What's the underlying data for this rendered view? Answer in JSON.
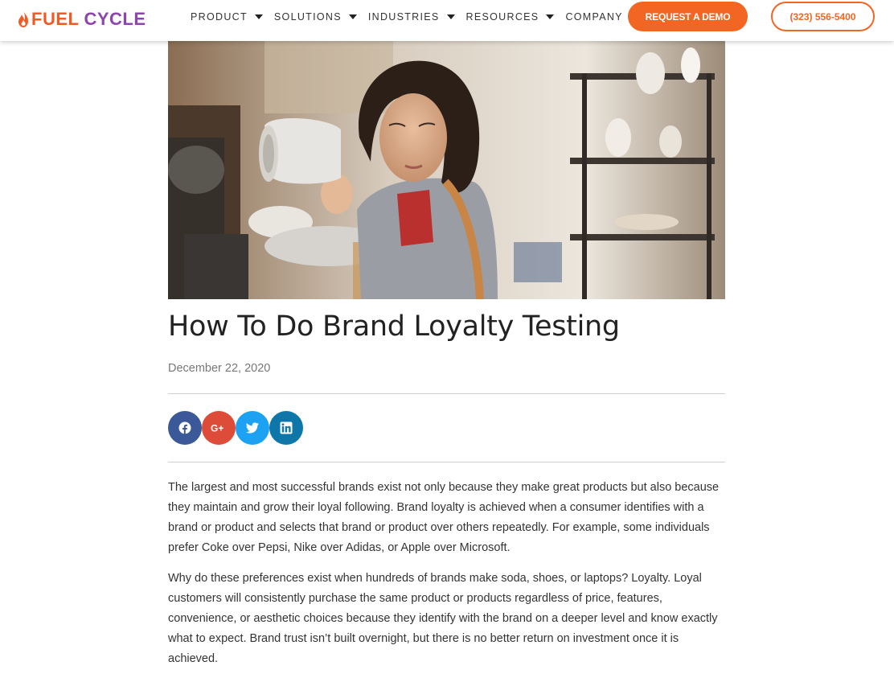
{
  "brand": {
    "logo_part1": "FUEL",
    "logo_part2": "CYCLE",
    "accent": "#f26522",
    "secondary": "#8e44ad"
  },
  "nav": {
    "items": [
      {
        "label": "PRODUCT"
      },
      {
        "label": "SOLUTIONS"
      },
      {
        "label": "INDUSTRIES"
      },
      {
        "label": "RESOURCES"
      },
      {
        "label": "COMPANY"
      }
    ],
    "demo_label": "REQUEST A DEMO",
    "phone_label": "(323) 556-5400"
  },
  "article": {
    "title": "How To Do Brand Loyalty Testing",
    "date": "December 22, 2020",
    "paragraphs": [
      "The largest and most successful brands exist not only because they make great products but also because they maintain and grow their loyal following. Brand loyalty is achieved when a consumer identifies with a brand or product and selects that brand or product over others repeatedly. For example, some individuals prefer Coke over Pepsi, Nike over Adidas, or Apple over Microsoft.",
      "Why do these preferences exist when hundreds of brands make soda, shoes, or laptops? Loyalty. Loyal customers will consistently purchase the same product or products regardless of price, features, convenience, or aesthetic choices because they identify with the brand on a deeper level and know exactly what to expect. Brand trust isn’t built overnight, but there is no better return on investment once it is achieved."
    ]
  },
  "share": {
    "icons": [
      "facebook-icon",
      "google-plus-icon",
      "twitter-icon",
      "linkedin-icon"
    ],
    "colors": {
      "facebook": "#3b5998",
      "google_plus": "#dd4b39",
      "twitter": "#1da1f2",
      "linkedin": "#0e76a8"
    }
  }
}
